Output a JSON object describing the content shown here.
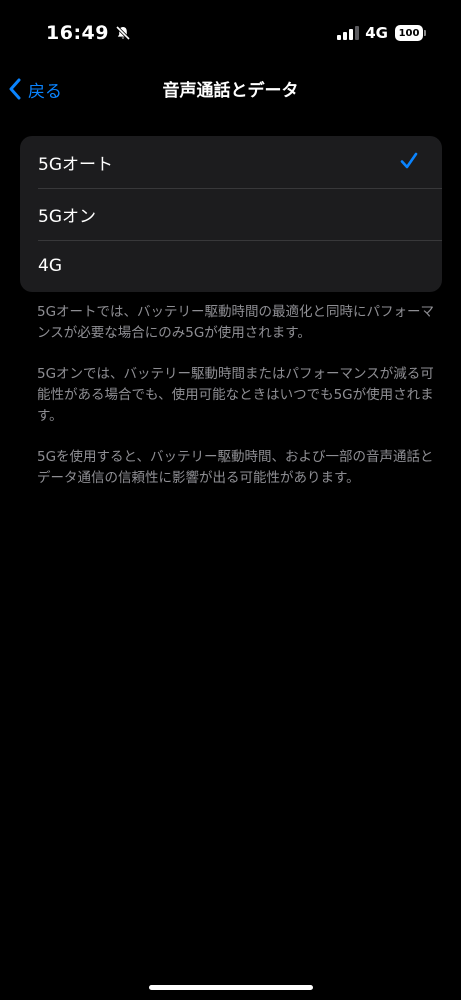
{
  "status_bar": {
    "time": "16:49",
    "network": "4G",
    "battery": "100"
  },
  "nav": {
    "back_label": "戻る",
    "title": "音声通話とデータ"
  },
  "options": [
    {
      "label": "5Gオート",
      "selected": true
    },
    {
      "label": "5Gオン",
      "selected": false
    },
    {
      "label": "4G",
      "selected": false
    }
  ],
  "footer_notes": [
    "5Gオートでは、バッテリー駆動時間の最適化と同時にパフォーマンスが必要な場合にのみ5Gが使用されます。",
    "5Gオンでは、バッテリー駆動時間またはパフォーマンスが減る可能性がある場合でも、使用可能なときはいつでも5Gが使用されます。",
    "5Gを使用すると、バッテリー駆動時間、および一部の音声通話とデータ通信の信頼性に影響が出る可能性があります。"
  ],
  "colors": {
    "accent": "#0a84ff",
    "background": "#000000",
    "group_background": "#1c1c1e",
    "secondary_text": "#8e8e93"
  },
  "icons": {
    "status": [
      "bell-slash-icon",
      "cellular-signal-icon",
      "battery-icon"
    ],
    "nav": "chevron-left-icon",
    "selection": "checkmark-icon"
  }
}
